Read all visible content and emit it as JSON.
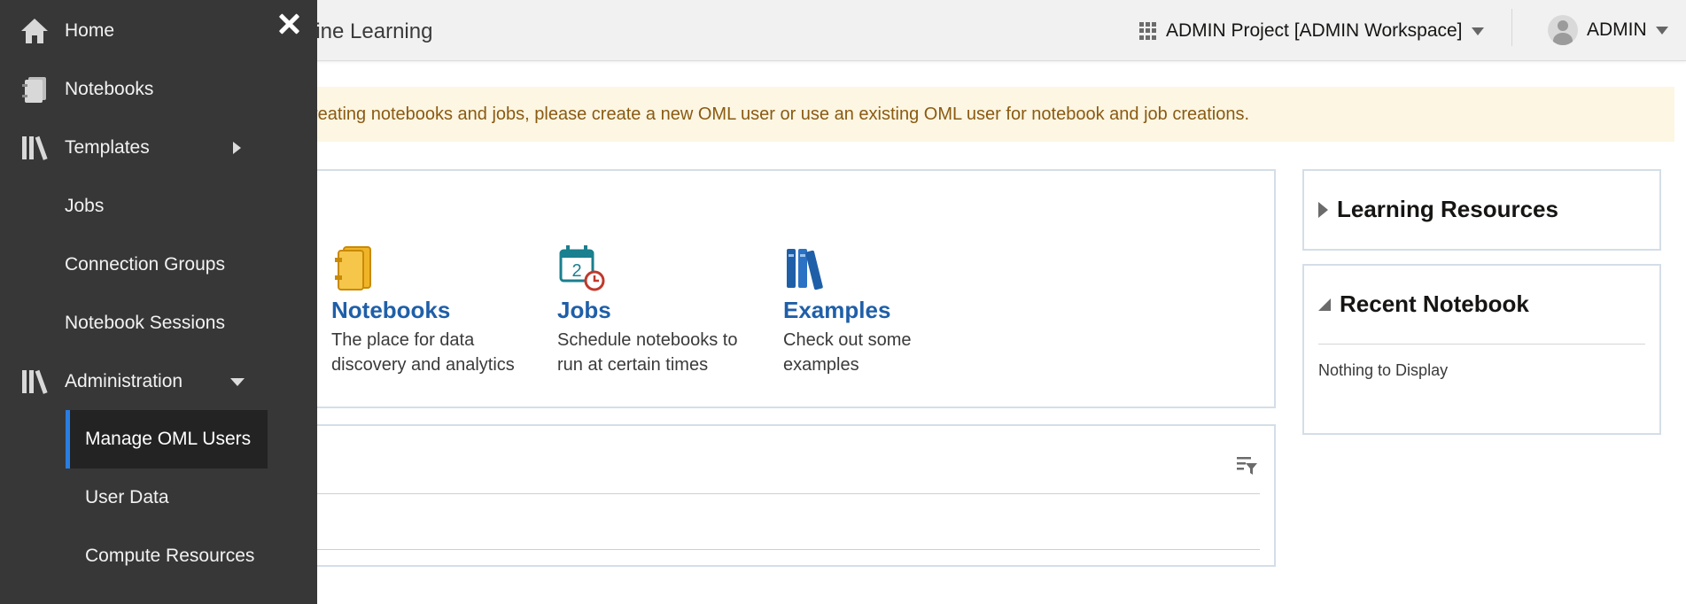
{
  "header": {
    "app_title_partial": "hine Learning",
    "project_selector": "ADMIN Project [ADMIN Workspace]",
    "user_name": "ADMIN"
  },
  "banner": {
    "message_partial": "reating notebooks and jobs, please create a new OML user or use an existing OML user for notebook and job creations."
  },
  "quick_actions": [
    {
      "title": "Notebooks",
      "line1": "The place for data",
      "line2": "discovery and analytics",
      "icon": "notebook-icon"
    },
    {
      "title": "Jobs",
      "line1": "Schedule notebooks to",
      "line2": "run at certain times",
      "icon": "calendar-clock-icon",
      "icon_day": "2"
    },
    {
      "title": "Examples",
      "line1": "Check out some",
      "line2": "examples",
      "icon": "books-icon"
    }
  ],
  "learning_resources": {
    "title": "Learning Resources"
  },
  "recent_notebook": {
    "title": "Recent Notebook",
    "empty_text": "Nothing to Display"
  },
  "nav": {
    "items": [
      {
        "label": "Home",
        "icon": "home-icon"
      },
      {
        "label": "Notebooks",
        "icon": "notebooks-icon"
      },
      {
        "label": "Templates",
        "icon": "library-icon",
        "expanded": false
      },
      {
        "label": "Jobs"
      },
      {
        "label": "Connection Groups"
      },
      {
        "label": "Notebook Sessions"
      },
      {
        "label": "Administration",
        "icon": "library-icon",
        "expanded": true
      }
    ],
    "admin_items": [
      {
        "label": "Manage OML Users",
        "active": true
      },
      {
        "label": "User Data"
      },
      {
        "label": "Compute Resources"
      }
    ]
  },
  "colors": {
    "drawer_bg": "#373737",
    "active_indicator": "#2a7de1",
    "link_blue": "#1f5fa8",
    "banner_bg": "#fcf6e3",
    "banner_text": "#8a5a11",
    "notebook_icon": "#f0b429",
    "jobs_icon": "#1a7f8e",
    "examples_icon": "#1f5fa8"
  }
}
